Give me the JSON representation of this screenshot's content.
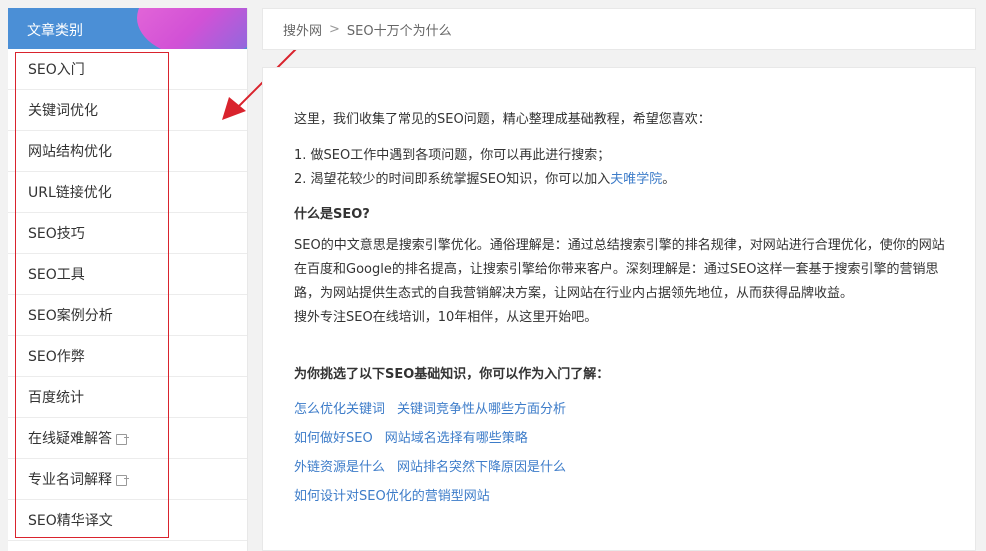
{
  "sidebar": {
    "title": "文章类别",
    "items": [
      {
        "label": "SEO入门",
        "external": false
      },
      {
        "label": "关键词优化",
        "external": false
      },
      {
        "label": "网站结构优化",
        "external": false
      },
      {
        "label": "URL链接优化",
        "external": false
      },
      {
        "label": "SEO技巧",
        "external": false
      },
      {
        "label": "SEO工具",
        "external": false
      },
      {
        "label": "SEO案例分析",
        "external": false
      },
      {
        "label": "SEO作弊",
        "external": false
      },
      {
        "label": "百度统计",
        "external": false
      },
      {
        "label": "在线疑难解答",
        "external": true
      },
      {
        "label": "专业名词解释",
        "external": true
      },
      {
        "label": "SEO精华译文",
        "external": false
      }
    ]
  },
  "breadcrumb": {
    "home": "搜外网",
    "separator": ">",
    "current": "SEO十万个为什么"
  },
  "content": {
    "intro": "这里，我们收集了常见的SEO问题，精心整理成基础教程，希望您喜欢：",
    "point1": "1. 做SEO工作中遇到各项问题，你可以再此进行搜索；",
    "point2_text": "2. 渴望花较少的时间即系统掌握SEO知识，你可以加入",
    "point2_link": "夫唯学院",
    "point2_end": "。",
    "what_heading": "什么是SEO?",
    "what_body": "SEO的中文意思是搜索引擎优化。通俗理解是：通过总结搜索引擎的排名规律，对网站进行合理优化，使你的网站在百度和Google的排名提高，让搜索引擎给你带来客户。深刻理解是：通过SEO这样一套基于搜索引擎的营销思路，为网站提供生态式的自我营销解决方案，让网站在行业内占据领先地位，从而获得品牌收益。",
    "tagline": "搜外专注SEO在线培训，10年相伴，从这里开始吧。",
    "picks_heading": "为你挑选了以下SEO基础知识，你可以作为入门了解：",
    "link_rows": [
      [
        "怎么优化关键词",
        "关键词竞争性从哪些方面分析"
      ],
      [
        "如何做好SEO",
        "网站域名选择有哪些策略"
      ],
      [
        "外链资源是什么",
        "网站排名突然下降原因是什么"
      ],
      [
        "如何设计对SEO优化的营销型网站"
      ]
    ]
  },
  "colors": {
    "header_blue": "#4b8fd6",
    "link_blue": "#3d7cc9",
    "annotation_red": "#d9232d"
  }
}
